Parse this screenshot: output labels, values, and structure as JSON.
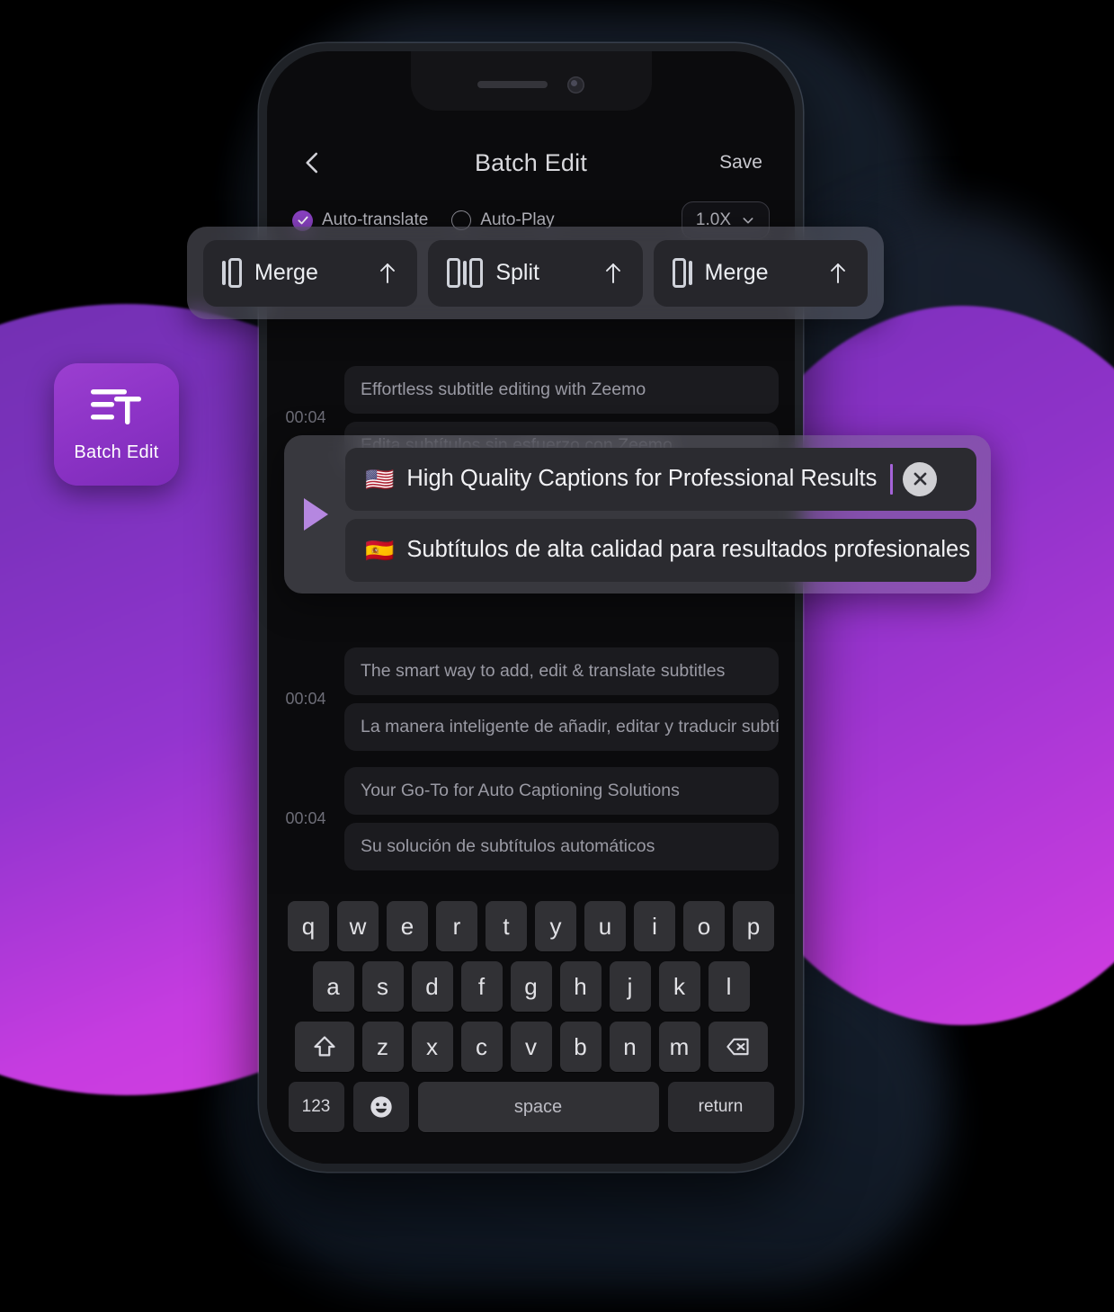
{
  "app_tile": {
    "label": "Batch Edit",
    "icon": "text-lines-t-icon",
    "color": "#8c33c6"
  },
  "phone": {
    "notch": {
      "speaker": "speaker-grille",
      "camera": "front-camera"
    }
  },
  "header": {
    "back_icon": "chevron-left-icon",
    "title": "Batch Edit",
    "save_label": "Save"
  },
  "options": {
    "auto_translate": {
      "label": "Auto-translate",
      "checked": true
    },
    "auto_play": {
      "label": "Auto-Play",
      "checked": false
    },
    "speed": {
      "value": "1.0X",
      "chevron": "chevron-down-icon"
    }
  },
  "toolbar": {
    "buttons": [
      {
        "label": "Merge",
        "icon": "merge-left-icon",
        "action_icon": "arrow-up-icon"
      },
      {
        "label": "Split",
        "icon": "split-icon",
        "action_icon": "arrow-up-icon"
      },
      {
        "label": "Merge",
        "icon": "merge-right-icon",
        "action_icon": "arrow-up-icon"
      }
    ]
  },
  "subtitles": {
    "before": [
      {
        "timestamp": "00:04",
        "source": "Effortless subtitle editing with Zeemo",
        "translation": "Edita subtítulos sin esfuerzo con Zeemo"
      }
    ],
    "selected": {
      "play_icon": "play-triangle-icon",
      "source_flag": "🇺🇸",
      "source": "High Quality Captions for Professional Results",
      "clear_icon": "clear-x-icon",
      "translation_flag": "🇪🇸",
      "translation": "Subtítulos de alta calidad para resultados profesionales"
    },
    "after": [
      {
        "timestamp": "00:04",
        "source": "The smart way to add, edit & translate subtitles",
        "translation": "La manera inteligente de añadir, editar y traducir subtít"
      },
      {
        "timestamp": "00:04",
        "source": "Your Go-To for Auto Captioning Solutions",
        "translation": "Su solución de subtítulos automáticos"
      }
    ]
  },
  "keyboard": {
    "row1": [
      "q",
      "w",
      "e",
      "r",
      "t",
      "y",
      "u",
      "i",
      "o",
      "p"
    ],
    "row2": [
      "a",
      "s",
      "d",
      "f",
      "g",
      "h",
      "j",
      "k",
      "l"
    ],
    "row3": [
      "z",
      "x",
      "c",
      "v",
      "b",
      "n",
      "m"
    ],
    "shift_icon": "shift-up-icon",
    "backspace_icon": "backspace-delete-icon",
    "numbers_label": "123",
    "emoji_icon": "emoji-smiley-icon",
    "space_label": "space",
    "return_label": "return"
  }
}
